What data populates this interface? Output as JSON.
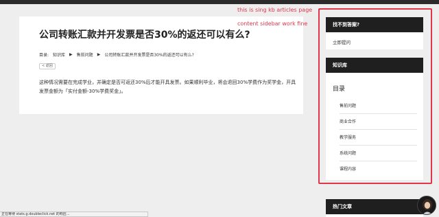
{
  "article": {
    "title": "公司转账汇款并开发票是否30%的返还可以有么?",
    "breadcrumb": {
      "prefix": "目录:",
      "items": [
        "知识库",
        "售前问题",
        "公司转账汇款并开发票是否30%的返还可以有么?"
      ],
      "separator": "▶"
    },
    "back_label": "< 返回",
    "body": "这种情况需要在完成学业，并确定是否可返还30%后才能开具发票。如果顺利毕业，将会退回30%学费作为奖学金，开具发票金额为「实付金额-30%学费奖金」。"
  },
  "annotations": {
    "line1": "this is sing kb articles page",
    "line2": "content sidebar work fine"
  },
  "sidebar": {
    "help": {
      "title": "找不到答案?",
      "link": "立即提问"
    },
    "kb": {
      "title": "知识库",
      "toc_title": "目录",
      "items": [
        "售前问题",
        "商业合作",
        "教学服务",
        "系统问题",
        "课程内容"
      ]
    },
    "hot": {
      "title": "热门文章"
    }
  },
  "statusbar": {
    "text": "正在等待 stats.g.doubleclick.net 的响应..."
  },
  "colors": {
    "annotation": "#e0364c",
    "widget_header": "#1f1f1f"
  },
  "icons": {
    "chat_avatar": "avatar"
  }
}
